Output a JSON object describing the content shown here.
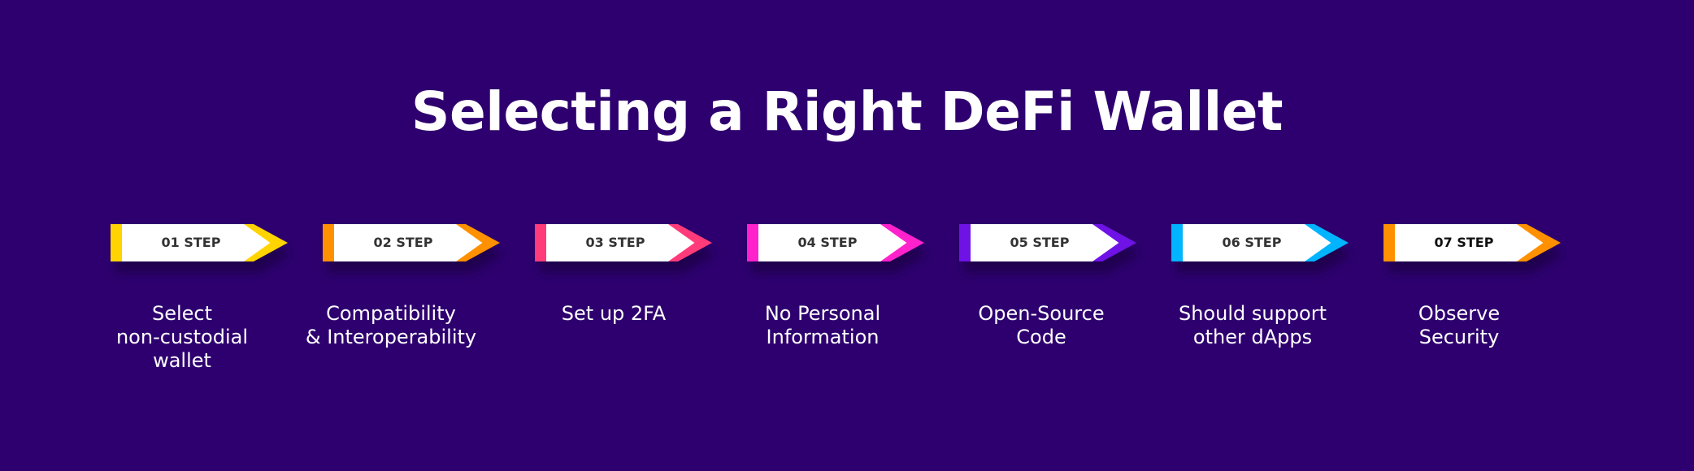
{
  "title": "Selecting a Right DeFi Wallet",
  "colors": {
    "background": "#2e006f",
    "box": "#ffffff",
    "shadow": "#1c0048"
  },
  "steps": [
    {
      "label": "01 STEP",
      "accent": "#ffd400",
      "description": "Select\nnon-custodial\nwallet"
    },
    {
      "label": "02 STEP",
      "accent": "#ff9100",
      "description": "Compatibility\n& Interoperability"
    },
    {
      "label": "03 STEP",
      "accent": "#ff3b7a",
      "description": "Set up 2FA"
    },
    {
      "label": "04 STEP",
      "accent": "#ff22cc",
      "description": "No Personal\nInformation"
    },
    {
      "label": "05 STEP",
      "accent": "#6f12e6",
      "description": "Open-Source\nCode"
    },
    {
      "label": "06 STEP",
      "accent": "#00b4ff",
      "description": "Should support\nother dApps"
    },
    {
      "label": "07 STEP",
      "accent": "#ff9100",
      "description": "Observe\nSecurity"
    }
  ]
}
